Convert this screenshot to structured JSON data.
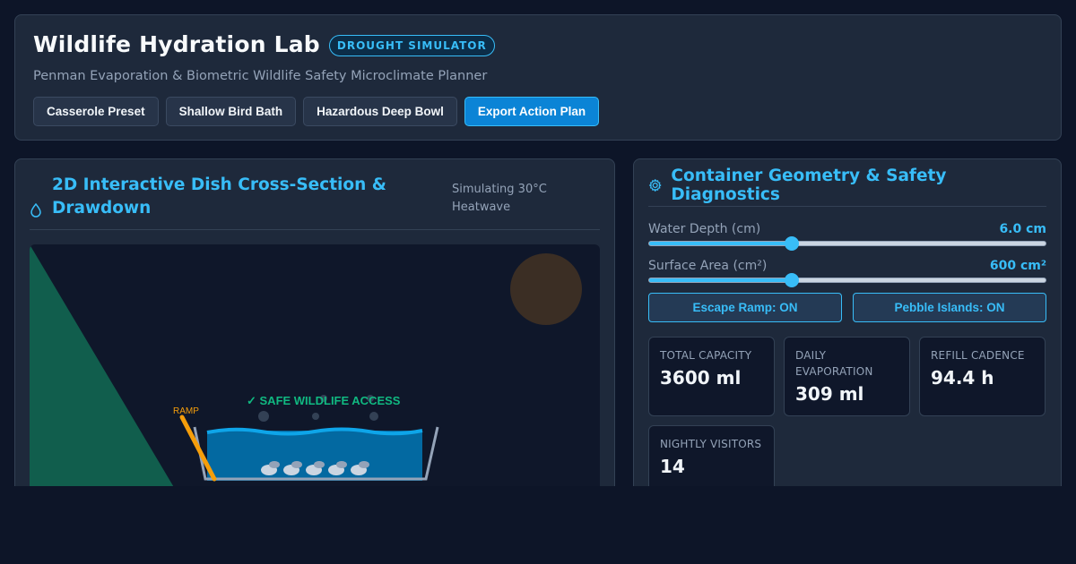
{
  "header": {
    "title": "Wildlife Hydration Lab",
    "badge": "DROUGHT SIMULATOR",
    "subtitle": "Penman Evaporation & Biometric Wildlife Safety Microclimate Planner",
    "buttons": {
      "casserole": "Casserole Preset",
      "bird_bath": "Shallow Bird Bath",
      "deep_bowl": "Hazardous Deep Bowl",
      "export": "Export Action Plan"
    }
  },
  "left_panel": {
    "title": "2D Interactive Dish Cross-Section & Drawdown",
    "simulation_label": "Simulating 30°C Heatwave",
    "canvas": {
      "ramp_label": "RAMP",
      "safe_label": "✓ SAFE WILDLIFE ACCESS",
      "water_color": "#0ea5e9",
      "ramp_color": "#f59e0b",
      "slope_color": "#115e4d",
      "sun_color": "#3b2e24",
      "pebble_count": 5
    }
  },
  "right_panel": {
    "title": "Container Geometry & Safety Diagnostics",
    "depth": {
      "label": "Water Depth (cm)",
      "value": "6.0 cm",
      "fraction": 0.36
    },
    "area": {
      "label": "Surface Area (cm²)",
      "value": "600 cm²",
      "fraction": 0.36
    },
    "toggles": {
      "ramp": "Escape Ramp: ON",
      "pebbles": "Pebble Islands: ON"
    },
    "stats": {
      "capacity": {
        "label": "TOTAL CAPACITY",
        "value": "3600 ml"
      },
      "evaporation": {
        "label": "DAILY EVAPORATION",
        "value": "309 ml"
      },
      "refill": {
        "label": "REFILL CADENCE",
        "value": "94.4 h"
      },
      "visitors": {
        "label": "NIGHTLY VISITORS",
        "value": "14"
      }
    }
  },
  "colors": {
    "accent": "#38bdf8",
    "background": "#0d1528",
    "panel": "#1e293b",
    "safe": "#10b981"
  }
}
